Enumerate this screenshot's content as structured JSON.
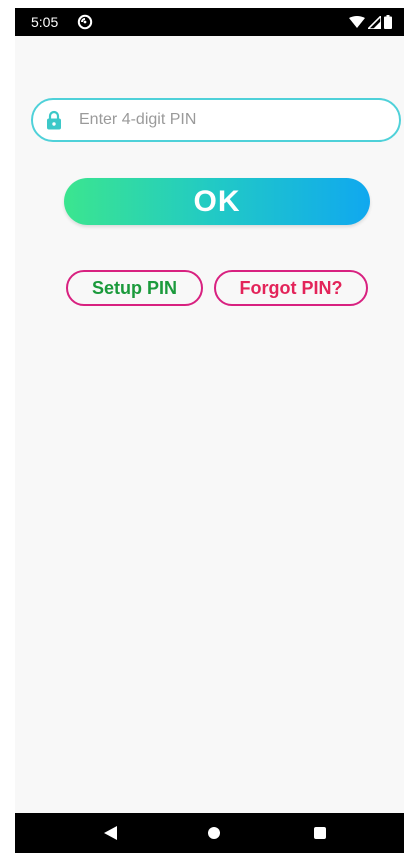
{
  "status_bar": {
    "time": "5:05",
    "app_icon": "notification-app-icon",
    "wifi_icon": "wifi-icon",
    "signal_icon": "signal-icon",
    "battery_icon": "battery-icon"
  },
  "pin_field": {
    "icon": "lock-icon",
    "placeholder": "Enter 4-digit PIN",
    "value": "",
    "border_color": "#4fd1d9",
    "icon_color": "#3cc8c8"
  },
  "ok_button": {
    "label": "OK",
    "gradient": [
      "#3be58f",
      "#21c9c6",
      "#10a8ef"
    ]
  },
  "links": {
    "setup_label": "Setup PIN",
    "setup_color": "#1b9a3c",
    "forgot_label": "Forgot PIN?",
    "forgot_color": "#e3245a",
    "outline_color": "#d82180"
  },
  "nav_bar": {
    "back_icon": "back-triangle-icon",
    "home_icon": "home-circle-icon",
    "recents_icon": "recents-square-icon"
  }
}
